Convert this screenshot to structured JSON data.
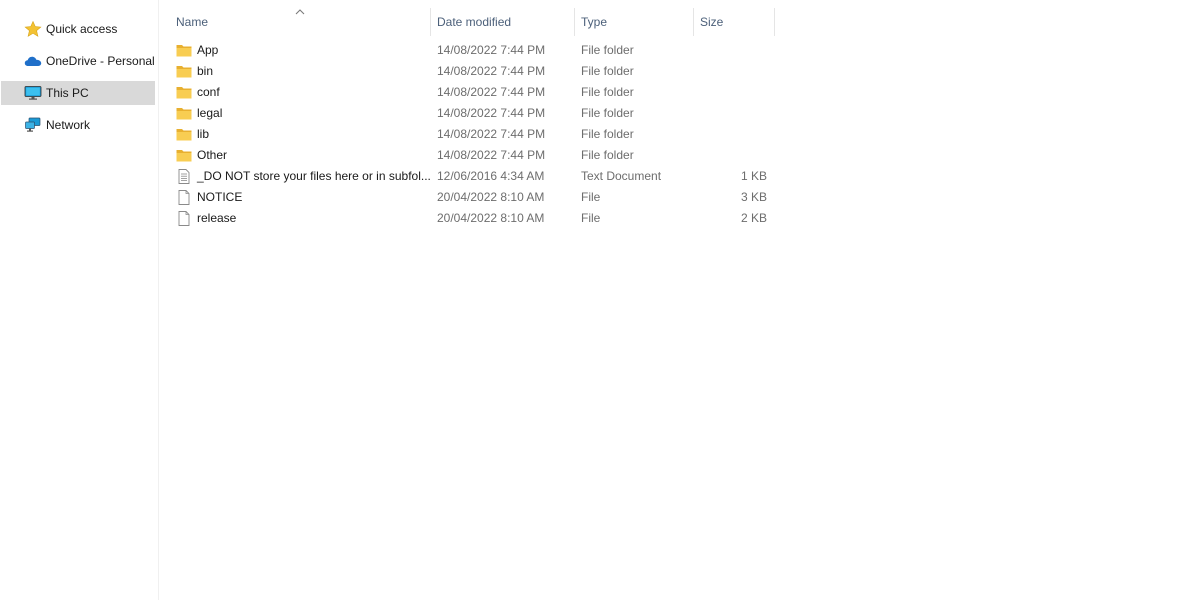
{
  "nav": {
    "items": [
      {
        "label": "Quick access",
        "icon": "star-icon",
        "selected": false
      },
      {
        "label": "OneDrive - Personal",
        "icon": "cloud-icon",
        "selected": false
      },
      {
        "label": "This PC",
        "icon": "monitor-icon",
        "selected": true
      },
      {
        "label": "Network",
        "icon": "network-icon",
        "selected": false
      }
    ]
  },
  "columns": {
    "name": "Name",
    "date": "Date modified",
    "type": "Type",
    "size": "Size",
    "sort_icon": "sort-up-icon"
  },
  "files": [
    {
      "name": "App",
      "date": "14/08/2022 7:44 PM",
      "type": "File folder",
      "size": "",
      "icon": "folder-icon"
    },
    {
      "name": "bin",
      "date": "14/08/2022 7:44 PM",
      "type": "File folder",
      "size": "",
      "icon": "folder-icon"
    },
    {
      "name": "conf",
      "date": "14/08/2022 7:44 PM",
      "type": "File folder",
      "size": "",
      "icon": "folder-icon"
    },
    {
      "name": "legal",
      "date": "14/08/2022 7:44 PM",
      "type": "File folder",
      "size": "",
      "icon": "folder-icon"
    },
    {
      "name": "lib",
      "date": "14/08/2022 7:44 PM",
      "type": "File folder",
      "size": "",
      "icon": "folder-icon"
    },
    {
      "name": "Other",
      "date": "14/08/2022 7:44 PM",
      "type": "File folder",
      "size": "",
      "icon": "folder-icon"
    },
    {
      "name": "_DO NOT store your files here or in subfol...",
      "date": "12/06/2016 4:34 AM",
      "type": "Text Document",
      "size": "1 KB",
      "icon": "text-document-icon"
    },
    {
      "name": "NOTICE",
      "date": "20/04/2022 8:10 AM",
      "type": "File",
      "size": "3 KB",
      "icon": "file-icon"
    },
    {
      "name": "release",
      "date": "20/04/2022 8:10 AM",
      "type": "File",
      "size": "2 KB",
      "icon": "file-icon"
    }
  ],
  "colors": {
    "folder": "#f5c440",
    "selected": "#d9d9d9",
    "header_text": "#4c607a"
  }
}
